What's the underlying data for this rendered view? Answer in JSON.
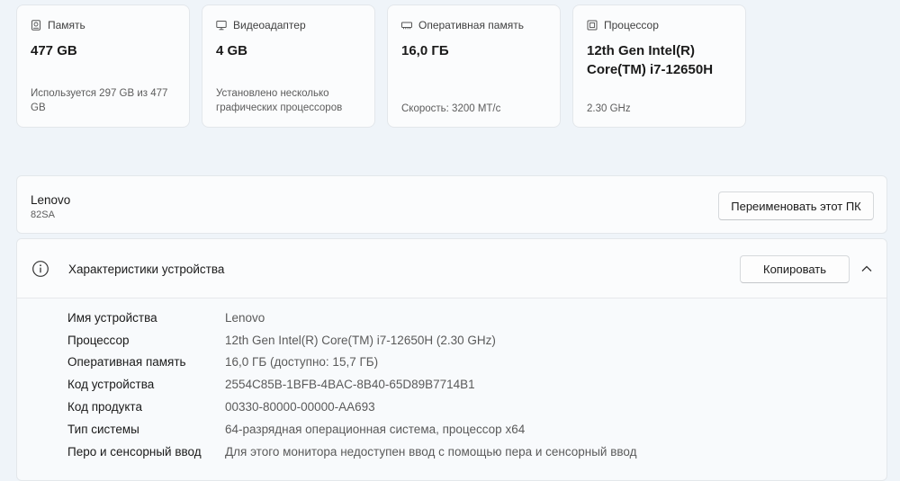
{
  "cards": [
    {
      "title": "Память",
      "icon": "storage-icon",
      "value": "477 GB",
      "sub": "Используется 297 GB из 477 GB"
    },
    {
      "title": "Видеоадаптер",
      "icon": "display-adapter-icon",
      "value": "4 GB",
      "sub": "Установлено несколько графических процессоров"
    },
    {
      "title": "Оперативная память",
      "icon": "ram-icon",
      "value": "16,0 ГБ",
      "sub": "Скорость: 3200 МТ/с"
    },
    {
      "title": "Процессор",
      "icon": "processor-icon",
      "value": "12th Gen Intel(R) Core(TM) i7-12650H",
      "sub": "2.30 GHz"
    }
  ],
  "device": {
    "name": "Lenovo",
    "model": "82SA",
    "rename_label": "Переименовать этот ПК"
  },
  "specs": {
    "title": "Характеристики устройства",
    "copy_label": "Копировать",
    "rows": [
      {
        "label": "Имя устройства",
        "value": "Lenovo"
      },
      {
        "label": "Процессор",
        "value": "12th Gen Intel(R) Core(TM) i7-12650H (2.30 GHz)"
      },
      {
        "label": "Оперативная память",
        "value": "16,0 ГБ (доступно: 15,7 ГБ)"
      },
      {
        "label": "Код устройства",
        "value": "2554C85B-1BFB-4BAC-8B40-65D89B7714B1"
      },
      {
        "label": "Код продукта",
        "value": "00330-80000-00000-AA693"
      },
      {
        "label": "Тип системы",
        "value": "64-разрядная операционная система, процессор x64"
      },
      {
        "label": "Перо и сенсорный ввод",
        "value": "Для этого монитора недоступен ввод с помощью пера и сенсорный ввод"
      }
    ]
  }
}
